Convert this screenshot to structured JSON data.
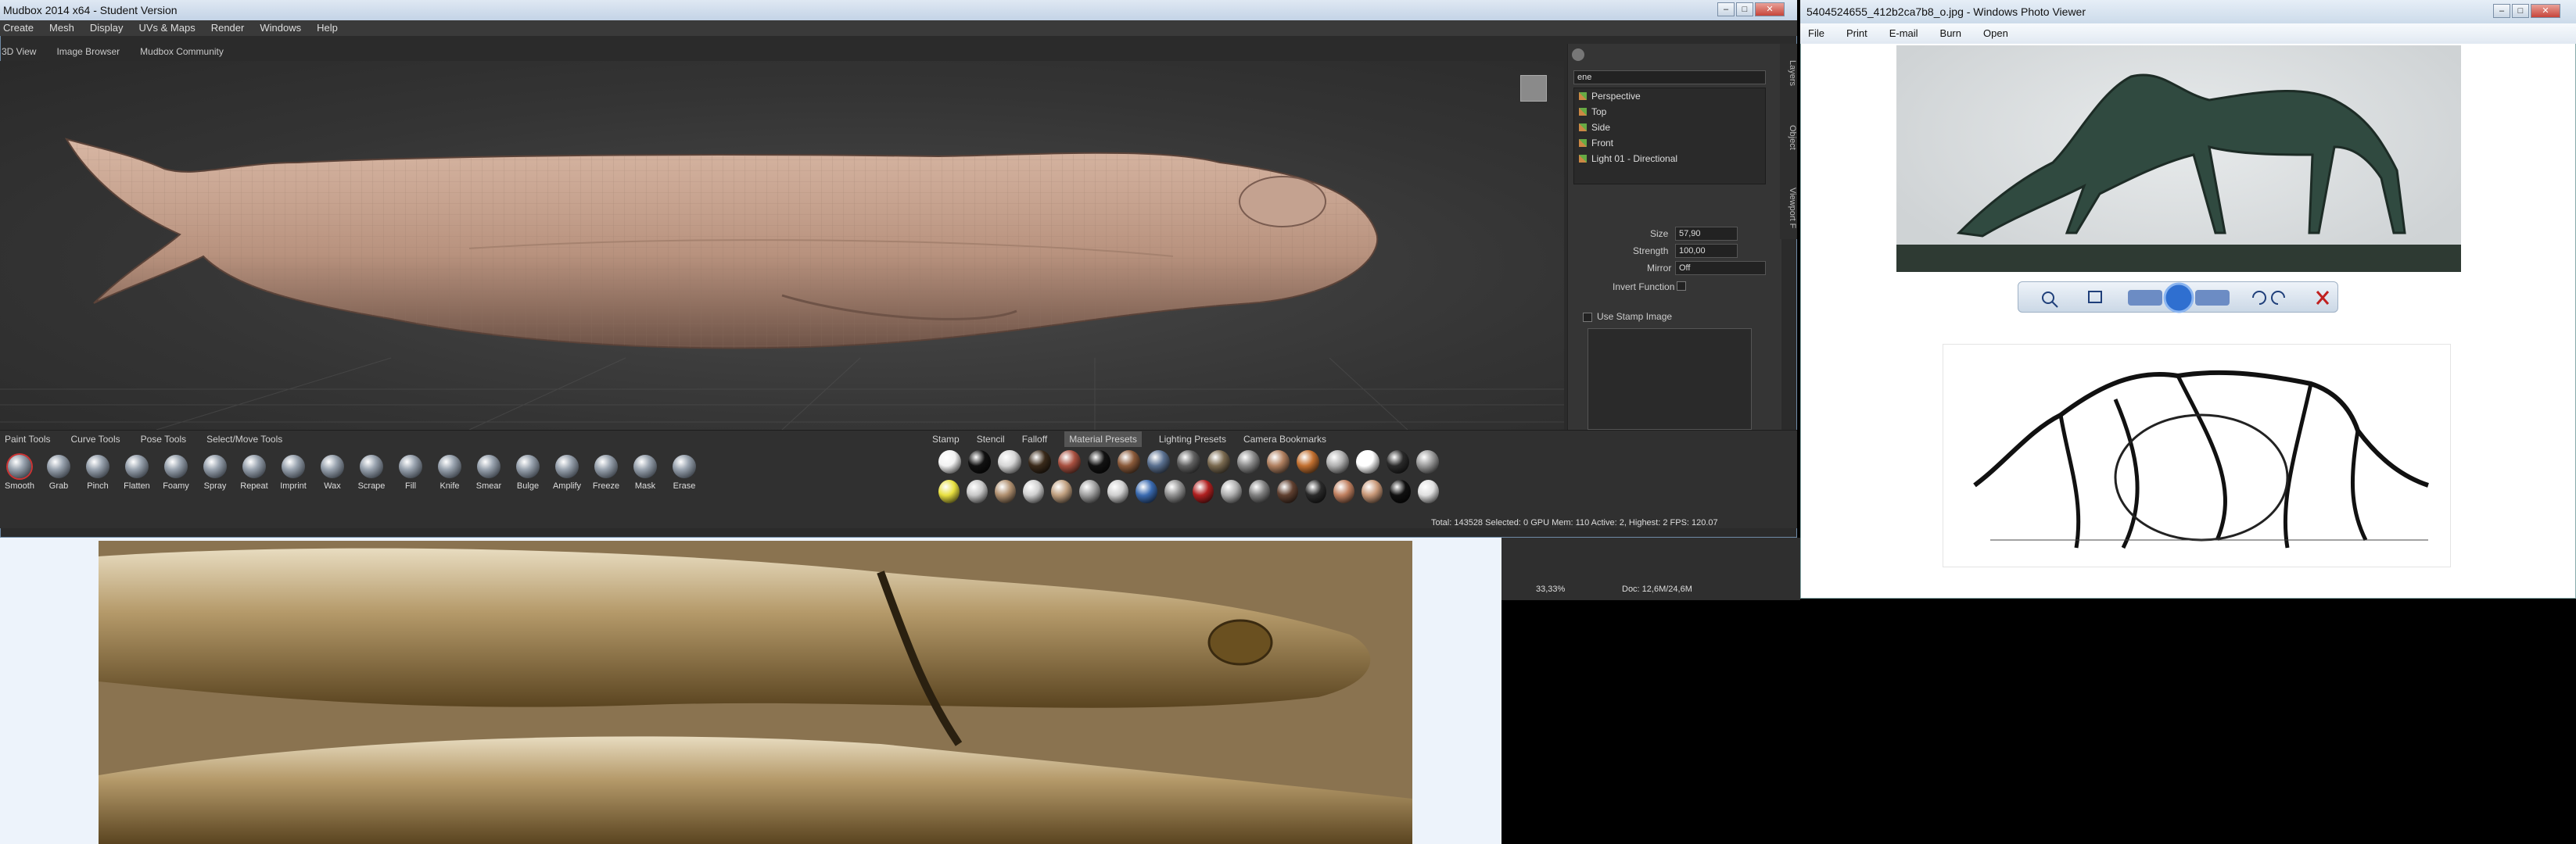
{
  "mudbox": {
    "title": "Mudbox 2014 x64 - Student Version",
    "menu": [
      "Create",
      "Mesh",
      "Display",
      "UVs & Maps",
      "Render",
      "Windows",
      "Help"
    ],
    "tabs": [
      "3D View",
      "Image Browser",
      "Mudbox Community"
    ],
    "scene_objects": [
      "Perspective",
      "Top",
      "Side",
      "Front",
      "Light 01 - Directional"
    ],
    "scene_header": "ene",
    "props": {
      "size_label": "Size",
      "size_value": "57,90",
      "strength_label": "Strength",
      "strength_value": "100,00",
      "mirror_label": "Mirror",
      "mirror_value": "Off",
      "invert_label": "Invert Function",
      "stamp_label": "Use Stamp Image"
    },
    "side_tabs": [
      "Layers",
      "Object",
      "Viewport F"
    ],
    "tool_tabs": [
      "Paint Tools",
      "Curve Tools",
      "Pose Tools",
      "Select/Move Tools"
    ],
    "tools": [
      "Smooth",
      "Grab",
      "Pinch",
      "Flatten",
      "Foamy",
      "Spray",
      "Repeat",
      "Imprint",
      "Wax",
      "Scrape",
      "Fill",
      "Knife",
      "Smear",
      "Bulge",
      "Amplify",
      "Freeze",
      "Mask",
      "Erase"
    ],
    "material_tabs": [
      "Stamp",
      "Stencil",
      "Falloff",
      "Material Presets",
      "Lighting Presets",
      "Camera Bookmarks"
    ],
    "active_material_tab": "Material Presets",
    "material_colors_row1": [
      "#f2f2f2",
      "#111111",
      "#d6d6d6",
      "#3a2a1a",
      "#a85040",
      "#121212",
      "#8a5a3a",
      "#5a7090",
      "#606060",
      "#7a6a50",
      "#8a8a8a",
      "#b08060",
      "#c27030",
      "#b0b0b0",
      "#ffffff",
      "#2a2a2a",
      "#9a9a9a"
    ],
    "material_colors_row2": [
      "#e8e040",
      "#c8c8c8",
      "#b09070",
      "#d0d0d0",
      "#c0a080",
      "#a0a0a0",
      "#cfcfcf",
      "#3a6ab0",
      "#909090",
      "#b02020",
      "#b0b0b0",
      "#808080",
      "#604030",
      "#2a2a2a",
      "#c08060",
      "#c89878",
      "#101010",
      "#e0e0e0"
    ],
    "status": "Total: 143528  Selected: 0  GPU Mem: 110  Active: 2, Highest: 2  FPS: 120.07"
  },
  "photoviewer": {
    "title": "5404524655_412b2ca7b8_o.jpg - Windows Photo Viewer",
    "menu": [
      "File",
      "Print",
      "E-mail",
      "Burn",
      "Open"
    ]
  },
  "photoshop": {
    "zoom": "33,33%",
    "doc": "Doc: 12,6M/24,6M"
  }
}
